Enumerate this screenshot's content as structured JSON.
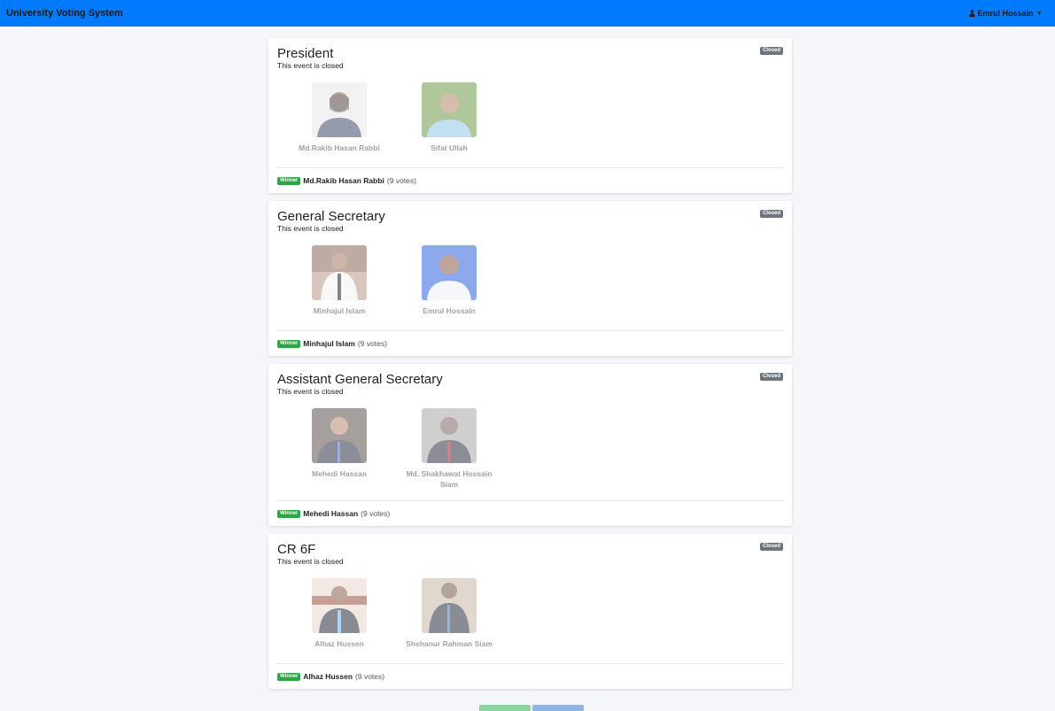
{
  "navbar": {
    "brand": "University Voting System",
    "user": "Emrul Hossain",
    "user_icon": "user-icon",
    "caret": "▾"
  },
  "events": [
    {
      "title": "President",
      "status": "This event is closed",
      "badge": "Closed",
      "candidates": [
        {
          "name": "Md.Rakib Hasan Rabbi",
          "photo_bg": "#5a5f6e"
        },
        {
          "name": "Sifat Ullah",
          "photo_bg": "#8fb06a"
        }
      ],
      "winner_badge": "Winner",
      "winner_name": "Md.Rakib Hasan Rabbi",
      "winner_votes": "(9 votes)"
    },
    {
      "title": "General Secretary",
      "status": "This event is closed",
      "badge": "Closed",
      "candidates": [
        {
          "name": "Minhajul Islam",
          "photo_bg": "#9c8c84"
        },
        {
          "name": "Emrul Hossain",
          "photo_bg": "#3f6fd8"
        }
      ],
      "winner_badge": "Winner",
      "winner_name": "Minhajul Islam",
      "winner_votes": "(9 votes)"
    },
    {
      "title": "Assistant General Secretary",
      "status": "This event is closed",
      "badge": "Closed",
      "candidates": [
        {
          "name": "Mehedi Hassan",
          "photo_bg": "#6a6560"
        },
        {
          "name": "Md. Shakhawat Hossain Siam",
          "photo_bg": "#a0a0a0"
        }
      ],
      "winner_badge": "Winner",
      "winner_name": "Mehedi Hassan",
      "winner_votes": "(9 votes)"
    },
    {
      "title": "CR 6F",
      "status": "This event is closed",
      "badge": "Closed",
      "candidates": [
        {
          "name": "Alhaz Hussen",
          "photo_bg": "#7a5a50"
        },
        {
          "name": "Shehanur Rahman Siam",
          "photo_bg": "#8a7a68"
        }
      ],
      "winner_badge": "Winner",
      "winner_name": "Alhaz Hussen",
      "winner_votes": "(9 votes)"
    }
  ]
}
